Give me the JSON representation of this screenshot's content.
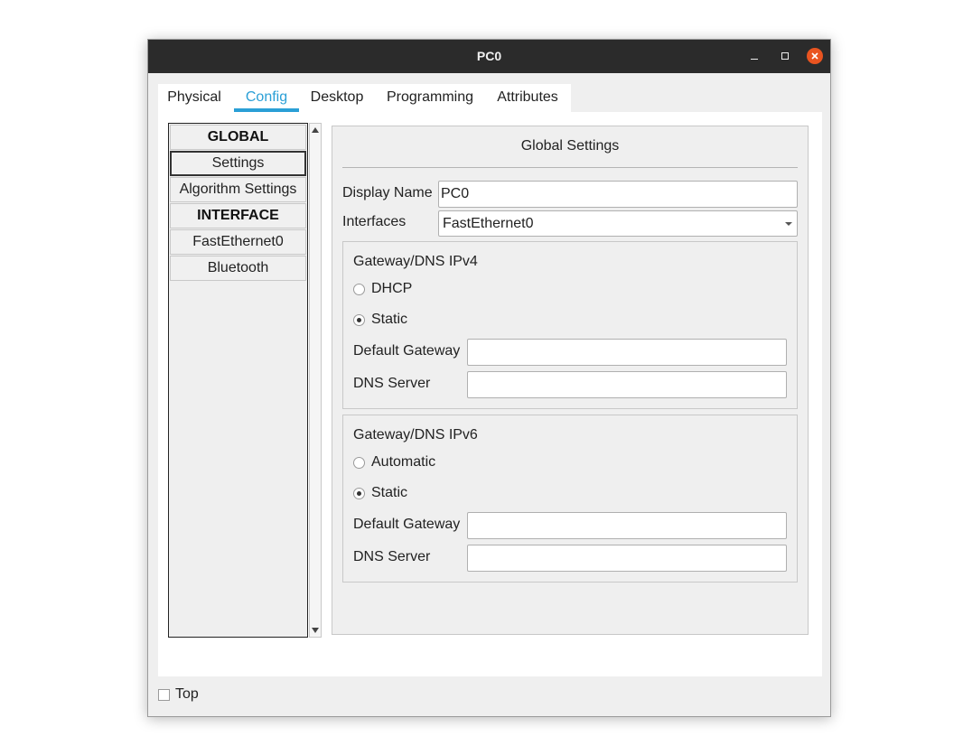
{
  "window": {
    "title": "PC0"
  },
  "tabs": [
    {
      "label": "Physical"
    },
    {
      "label": "Config",
      "active": true
    },
    {
      "label": "Desktop"
    },
    {
      "label": "Programming"
    },
    {
      "label": "Attributes"
    }
  ],
  "nav": {
    "items": [
      {
        "label": "GLOBAL",
        "type": "header"
      },
      {
        "label": "Settings",
        "selected": true
      },
      {
        "label": "Algorithm Settings"
      },
      {
        "label": "INTERFACE",
        "type": "header"
      },
      {
        "label": "FastEthernet0"
      },
      {
        "label": "Bluetooth"
      }
    ]
  },
  "settings": {
    "title": "Global Settings",
    "display_name_label": "Display Name",
    "display_name_value": "PC0",
    "interfaces_label": "Interfaces",
    "interfaces_value": "FastEthernet0",
    "ipv4": {
      "title": "Gateway/DNS IPv4",
      "option_dhcp": "DHCP",
      "option_static": "Static",
      "selected": "Static",
      "gateway_label": "Default Gateway",
      "gateway_value": "",
      "dns_label": "DNS Server",
      "dns_value": ""
    },
    "ipv6": {
      "title": "Gateway/DNS IPv6",
      "option_auto": "Automatic",
      "option_static": "Static",
      "selected": "Static",
      "gateway_label": "Default Gateway",
      "gateway_value": "",
      "dns_label": "DNS Server",
      "dns_value": ""
    }
  },
  "footer": {
    "top_label": "Top",
    "top_checked": false
  },
  "colors": {
    "accent": "#2a9fd6",
    "titlebar": "#2b2b2b",
    "close": "#e95420"
  }
}
